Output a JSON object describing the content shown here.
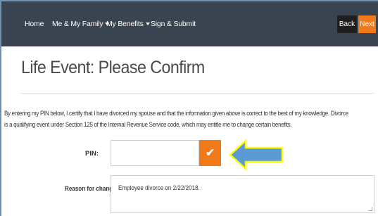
{
  "nav": {
    "items": [
      {
        "label": "Home",
        "dropdown": false
      },
      {
        "label": "Me & My Family",
        "dropdown": true
      },
      {
        "label": "My Benefits",
        "dropdown": true
      },
      {
        "label": "Sign & Submit",
        "dropdown": false
      }
    ],
    "back_label": "Back",
    "next_label": "Next"
  },
  "page": {
    "title": "Life Event: Please Confirm",
    "disclaimer_line1": "By entering my PIN below, I certify that I have divorced my spouse and that the information given above is correct to the best of my knowledge. Divorce",
    "disclaimer_line2": "is a qualifying event under Section 125 of the Internal Revenue Service code, which may entitle me to change certain benefits."
  },
  "form": {
    "pin_label": "PIN:",
    "pin_value": "",
    "confirm_icon": "checkmark-icon",
    "reason_label": "Reason for change:",
    "reason_value": "Employee divorce on 2/22/2018."
  },
  "colors": {
    "navbar": "#3a4450",
    "accent": "#f07a1a",
    "arrow_fill": "#5b9bd5",
    "arrow_stroke": "#ffff00"
  }
}
